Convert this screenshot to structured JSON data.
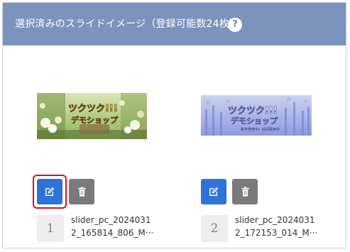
{
  "header": {
    "title": "選択済みのスライドイメージ（登録可能数24枚）",
    "help_icon": "?"
  },
  "slides": [
    {
      "order": "1",
      "filename_line1": "slider_pc_2024031",
      "filename_line2": "2_165814_806_M···",
      "thumbnail_text": "ツクツク!!! デモショップ",
      "highlighted": true
    },
    {
      "order": "2",
      "filename_line1": "slider_pc_2024031",
      "filename_line2": "2_172153_014_M···",
      "thumbnail_text": "ツクツク!!! デモショップ",
      "thumbnail_subtext": "新作発売中！好評販売中",
      "highlighted": false
    }
  ],
  "icons": {
    "edit": "edit-icon",
    "delete": "trash-icon"
  },
  "colors": {
    "header_bg": "#7b93bd",
    "edit_button": "#2f73d8",
    "delete_button": "#7a7a7a",
    "highlight_border": "#d0121b"
  }
}
